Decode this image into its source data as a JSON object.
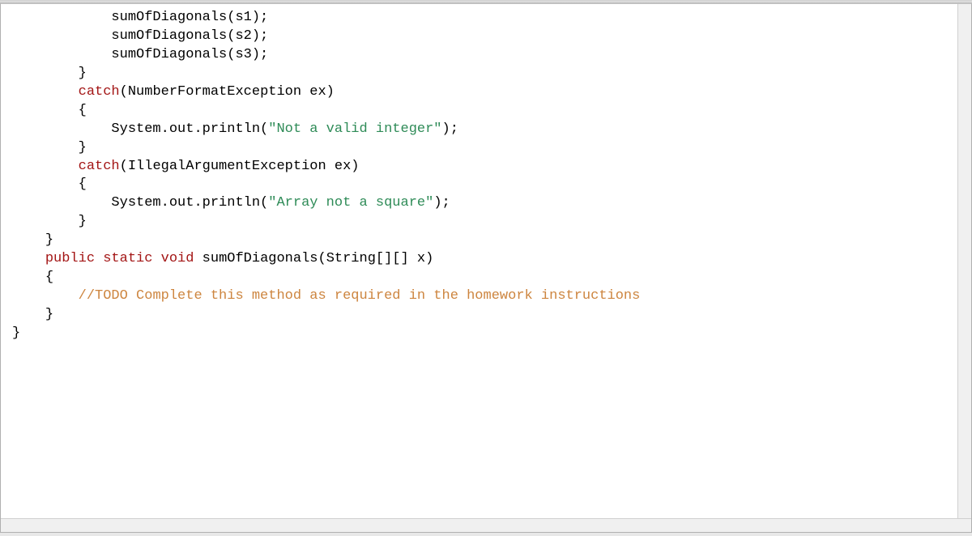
{
  "code": {
    "lines": [
      {
        "indent": 3,
        "segments": [
          {
            "text": "sumOfDiagonals(s1);",
            "cls": ""
          }
        ]
      },
      {
        "indent": 3,
        "segments": [
          {
            "text": "sumOfDiagonals(s2);",
            "cls": ""
          }
        ]
      },
      {
        "indent": 3,
        "segments": [
          {
            "text": "sumOfDiagonals(s3);",
            "cls": ""
          }
        ]
      },
      {
        "indent": 2,
        "segments": [
          {
            "text": "}",
            "cls": ""
          }
        ]
      },
      {
        "indent": 2,
        "segments": [
          {
            "text": "catch",
            "cls": "catch-kw"
          },
          {
            "text": "(NumberFormatException ex)",
            "cls": ""
          }
        ]
      },
      {
        "indent": 2,
        "segments": [
          {
            "text": "{",
            "cls": ""
          }
        ]
      },
      {
        "indent": 3,
        "segments": [
          {
            "text": "System.out.println(",
            "cls": ""
          },
          {
            "text": "\"Not a valid integer\"",
            "cls": "string"
          },
          {
            "text": ");",
            "cls": ""
          }
        ]
      },
      {
        "indent": 2,
        "segments": [
          {
            "text": "}",
            "cls": ""
          }
        ]
      },
      {
        "indent": 2,
        "segments": [
          {
            "text": "catch",
            "cls": "catch-kw"
          },
          {
            "text": "(IllegalArgumentException ex)",
            "cls": ""
          }
        ]
      },
      {
        "indent": 2,
        "segments": [
          {
            "text": "{",
            "cls": ""
          }
        ]
      },
      {
        "indent": 3,
        "segments": [
          {
            "text": "System.out.println(",
            "cls": ""
          },
          {
            "text": "\"Array not a square\"",
            "cls": "string"
          },
          {
            "text": ");",
            "cls": ""
          }
        ]
      },
      {
        "indent": 2,
        "segments": [
          {
            "text": "}",
            "cls": ""
          }
        ]
      },
      {
        "indent": 1,
        "segments": [
          {
            "text": "}",
            "cls": ""
          }
        ]
      },
      {
        "indent": 0,
        "segments": [
          {
            "text": "",
            "cls": ""
          }
        ]
      },
      {
        "indent": 1,
        "segments": [
          {
            "text": "public",
            "cls": "keyword"
          },
          {
            "text": " ",
            "cls": ""
          },
          {
            "text": "static",
            "cls": "keyword"
          },
          {
            "text": " ",
            "cls": ""
          },
          {
            "text": "void",
            "cls": "keyword"
          },
          {
            "text": " sumOfDiagonals(String[][] x)",
            "cls": ""
          }
        ]
      },
      {
        "indent": 1,
        "segments": [
          {
            "text": "{",
            "cls": ""
          }
        ]
      },
      {
        "indent": 2,
        "segments": [
          {
            "text": "//TODO Complete this method as required in the homework instructions",
            "cls": "comment"
          }
        ]
      },
      {
        "indent": 0,
        "segments": [
          {
            "text": "",
            "cls": ""
          }
        ]
      },
      {
        "indent": 0,
        "segments": [
          {
            "text": "",
            "cls": ""
          }
        ]
      },
      {
        "indent": 0,
        "segments": [
          {
            "text": "",
            "cls": ""
          }
        ]
      },
      {
        "indent": 0,
        "segments": [
          {
            "text": "",
            "cls": ""
          }
        ]
      },
      {
        "indent": 1,
        "segments": [
          {
            "text": "}",
            "cls": ""
          }
        ]
      },
      {
        "indent": 0,
        "segments": [
          {
            "text": "}",
            "cls": ""
          }
        ]
      }
    ]
  }
}
